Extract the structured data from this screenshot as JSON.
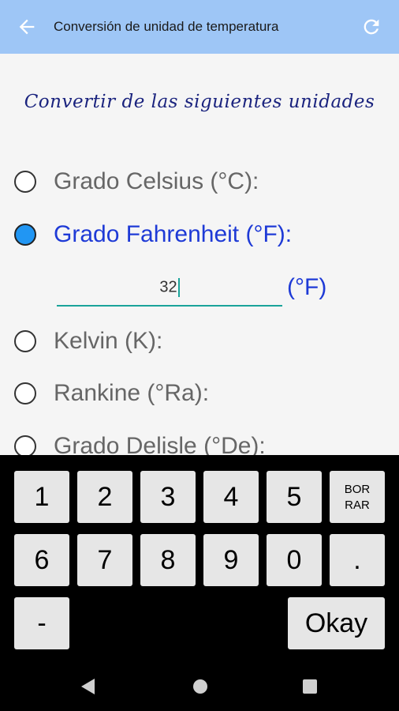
{
  "appbar": {
    "title": "Conversión de unidad de temperatura",
    "back_icon": "arrow-left-icon",
    "refresh_icon": "refresh-icon",
    "color": "#9ec6f6"
  },
  "heading": "Convertir de las siguientes unidades",
  "options": [
    {
      "label": "Grado Celsius (°C):",
      "checked": false
    },
    {
      "label": "Grado Fahrenheit (°F):",
      "checked": true
    },
    {
      "label": "Kelvin (K):",
      "checked": false
    },
    {
      "label": "Rankine (°Ra):",
      "checked": false
    },
    {
      "label": "Grado Delisle (°De):",
      "checked": false
    }
  ],
  "input": {
    "value": "32",
    "unit": "(°F)"
  },
  "keypad": {
    "keys": [
      "1",
      "2",
      "3",
      "4",
      "5",
      "BOR RAR",
      "6",
      "7",
      "8",
      "9",
      "0",
      ".",
      "-",
      "Okay"
    ]
  },
  "navbar": {
    "icons": [
      "back-triangle-icon",
      "home-circle-icon",
      "recents-square-icon"
    ]
  },
  "colors": {
    "accent": "#1e3ad6",
    "radio_checked": "#2196f3",
    "input_underline": "#1aa39a"
  }
}
